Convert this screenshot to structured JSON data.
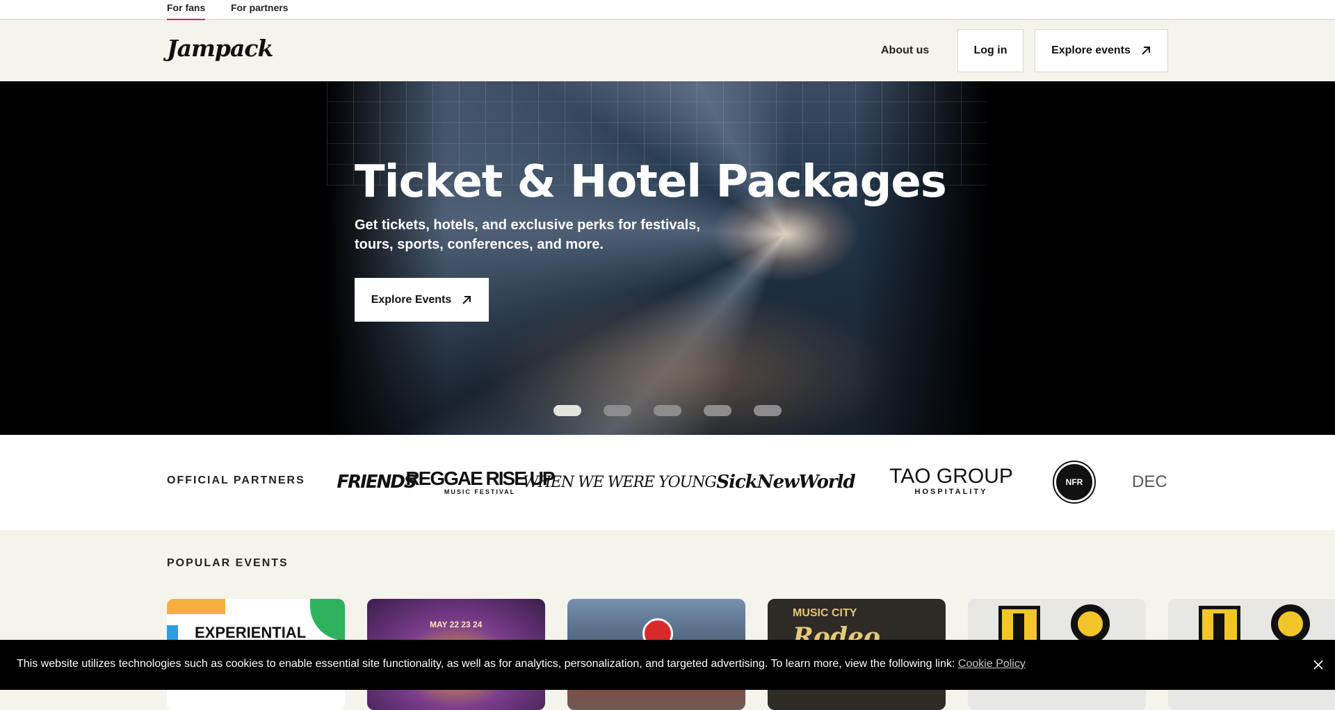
{
  "audience_tabs": [
    {
      "label": "For fans",
      "active": true
    },
    {
      "label": "For partners",
      "active": false
    }
  ],
  "header": {
    "logo": "Jampack",
    "about_label": "About us",
    "login_label": "Log in",
    "explore_label": "Explore events",
    "explore_icon": "arrow-up-right-icon"
  },
  "hero": {
    "title": "Ticket & Hotel Packages",
    "subtitle": "Get tickets, hotels, and exclusive perks for festivals, tours, sports, conferences, and more.",
    "cta_label": "Explore Events",
    "slides_count": 5,
    "active_slide": 1
  },
  "partners": {
    "label": "OFFICIAL PARTNERS",
    "logos": [
      {
        "name": "FRIENDS"
      },
      {
        "name": "REGGAE RISE UP",
        "sub": "MUSIC FESTIVAL"
      },
      {
        "name": "WHEN WE WERE YOUNG"
      },
      {
        "name": "SickNewWorld"
      },
      {
        "name": "TAO GROUP",
        "sub": "HOSPITALITY"
      },
      {
        "name": "NFR"
      },
      {
        "name": "DEC"
      }
    ]
  },
  "popular": {
    "title": "POPULAR EVENTS",
    "cards": [
      {
        "text": "EXPERIENTIAL"
      },
      {
        "text": "MAY 22 23 24"
      },
      {
        "text": ""
      },
      {
        "text": "MUSIC CITY",
        "text2": "Rodeo"
      },
      {
        "text": ""
      },
      {
        "text": ""
      }
    ]
  },
  "cookie": {
    "text": "This website utilizes technologies such as cookies to enable essential site functionality, as well as for analytics, personalization, and targeted advertising. To learn more, view the following link: ",
    "link_label": "Cookie Policy"
  },
  "colors": {
    "accent": "#d0266b",
    "header_bg": "#f4f3ec",
    "cookie_bg": "#000000"
  }
}
